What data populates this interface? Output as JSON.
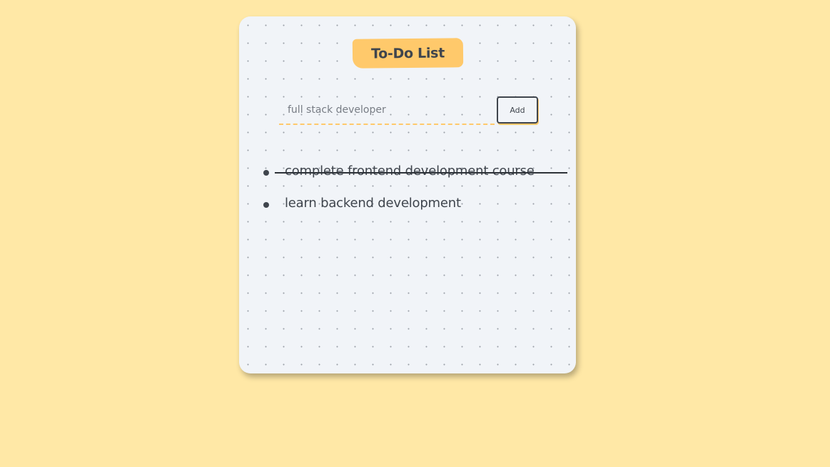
{
  "app": {
    "title": "To-Do List"
  },
  "input": {
    "value": "full stack developer",
    "placeholder": ""
  },
  "add_button": {
    "label": "Add"
  },
  "tasks": [
    {
      "text": "complete frontend development course",
      "completed": true
    },
    {
      "text": "learn backend development",
      "completed": false
    }
  ],
  "colors": {
    "page_background": "#ffe8a6",
    "card_background": "#f1f4f8",
    "accent": "#ffc96b",
    "text": "#3f454d"
  }
}
